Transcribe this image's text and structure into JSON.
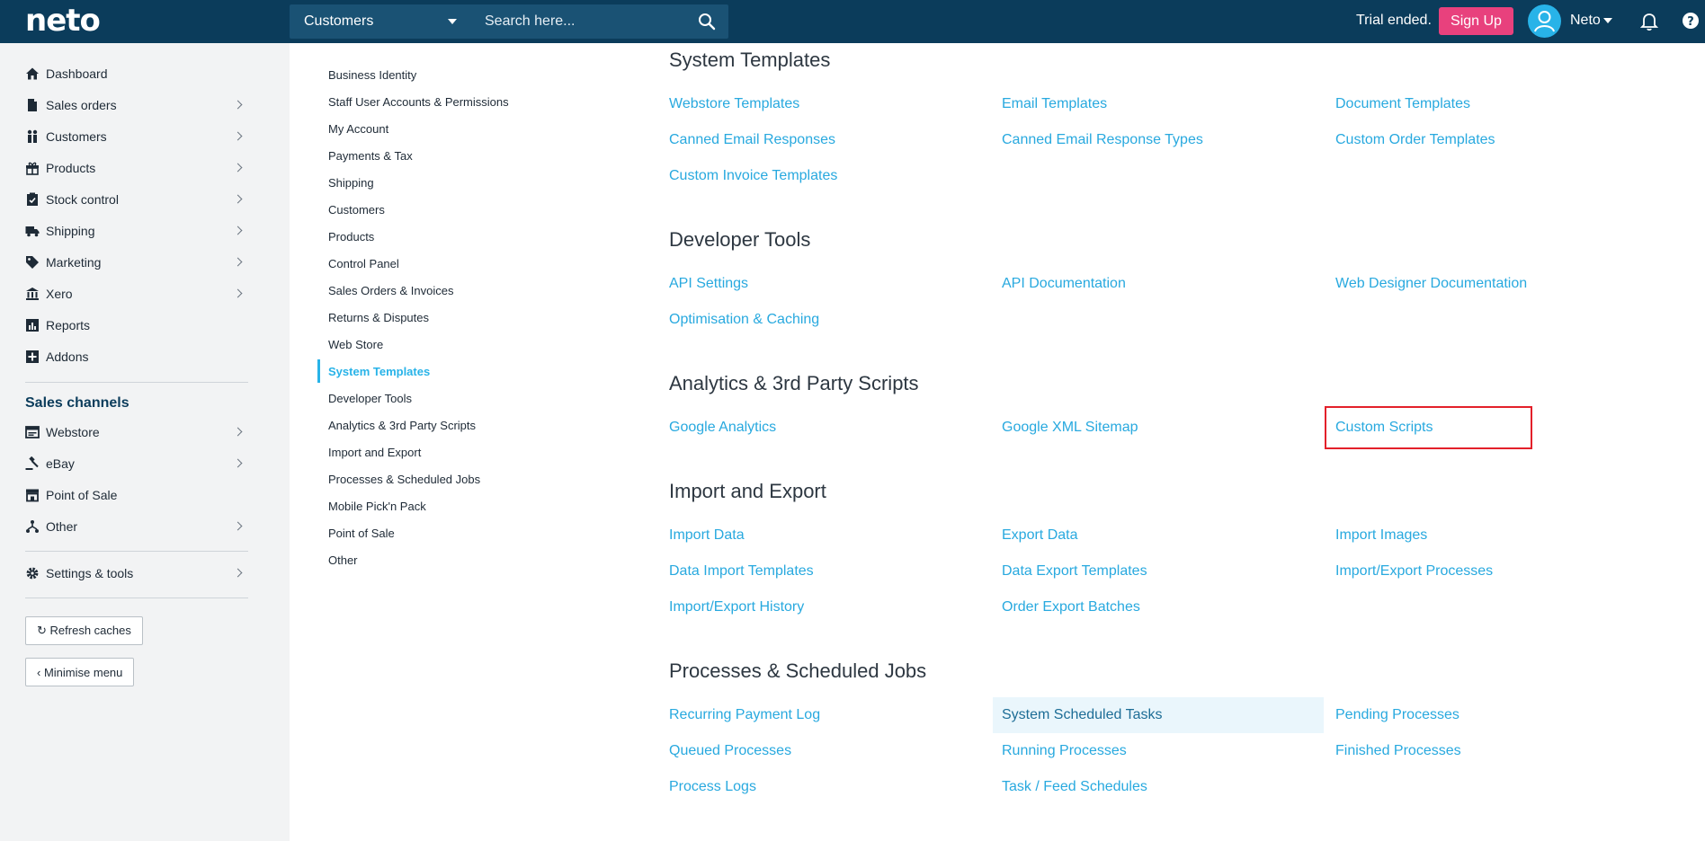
{
  "topbar": {
    "logo": "neto",
    "search_category": "Customers",
    "search_placeholder": "Search here...",
    "trial_text": "Trial ended.",
    "signup_label": "Sign Up",
    "user_name": "Neto"
  },
  "sidebar": {
    "items": [
      {
        "label": "Dashboard",
        "icon": "home-icon"
      },
      {
        "label": "Sales orders",
        "icon": "document-icon"
      },
      {
        "label": "Customers",
        "icon": "people-icon"
      },
      {
        "label": "Products",
        "icon": "gift-icon"
      },
      {
        "label": "Stock control",
        "icon": "clipboard-check-icon"
      },
      {
        "label": "Shipping",
        "icon": "truck-icon"
      },
      {
        "label": "Marketing",
        "icon": "tag-icon"
      },
      {
        "label": "Xero",
        "icon": "bank-icon"
      },
      {
        "label": "Reports",
        "icon": "report-icon"
      },
      {
        "label": "Addons",
        "icon": "plus-box-icon"
      }
    ],
    "channels_title": "Sales channels",
    "channels": [
      {
        "label": "Webstore",
        "icon": "browser-icon"
      },
      {
        "label": "eBay",
        "icon": "gavel-icon"
      },
      {
        "label": "Point of Sale",
        "icon": "store-icon"
      },
      {
        "label": "Other",
        "icon": "network-icon"
      }
    ],
    "settings_label": "Settings & tools",
    "refresh_label": "Refresh caches",
    "minimise_label": "Minimise menu"
  },
  "subnav": {
    "items": [
      "Business Identity",
      "Staff User Accounts & Permissions",
      "My Account",
      "Payments & Tax",
      "Shipping",
      "Customers",
      "Products",
      "Control Panel",
      "Sales Orders & Invoices",
      "Returns & Disputes",
      "Web Store",
      "System Templates",
      "Developer Tools",
      "Analytics & 3rd Party Scripts",
      "Import and Export",
      "Processes & Scheduled Jobs",
      "Mobile Pick'n Pack",
      "Point of Sale",
      "Other"
    ],
    "active": "System Templates"
  },
  "groups": {
    "system_templates": {
      "title": "System Templates",
      "links": [
        "Webstore Templates",
        "Email Templates",
        "Document Templates",
        "Canned Email Responses",
        "Canned Email Response Types",
        "Custom Order Templates",
        "Custom Invoice Templates"
      ]
    },
    "developer_tools": {
      "title": "Developer Tools",
      "links": [
        "API Settings",
        "API Documentation",
        "Web Designer Documentation",
        "Optimisation & Caching"
      ]
    },
    "analytics": {
      "title": "Analytics & 3rd Party Scripts",
      "links": [
        "Google Analytics",
        "Google XML Sitemap",
        "Custom Scripts"
      ]
    },
    "import_export": {
      "title": "Import and Export",
      "links": [
        "Import Data",
        "Export Data",
        "Import Images",
        "Data Import Templates",
        "Data Export Templates",
        "Import/Export Processes",
        "Import/Export History",
        "Order Export Batches"
      ]
    },
    "processes": {
      "title": "Processes & Scheduled Jobs",
      "links": [
        "Recurring Payment Log",
        "System Scheduled Tasks",
        "Pending Processes",
        "Queued Processes",
        "Running Processes",
        "Finished Processes",
        "Process Logs",
        "Task / Feed Schedules"
      ]
    }
  },
  "colors": {
    "topbar": "#0b3c5b",
    "link": "#28a9df",
    "accent_pink": "#e8417d",
    "highlight_box": "#e3202a"
  }
}
